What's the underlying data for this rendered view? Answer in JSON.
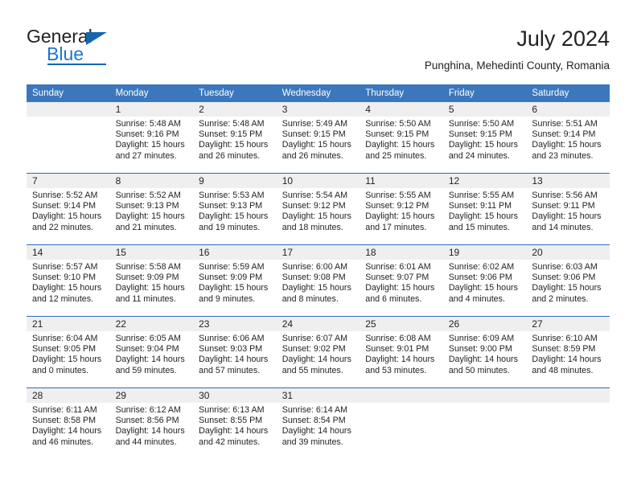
{
  "brand": {
    "name_part1": "General",
    "name_part2": "Blue",
    "logo_icon": "triangle-icon",
    "accent_color": "#1565b0"
  },
  "header": {
    "title": "July 2024",
    "subtitle": "Punghina, Mehedinti County, Romania"
  },
  "theme": {
    "header_blue": "#3b77bc",
    "row_line_blue": "#2d6eb4",
    "daynum_band_gray": "#efeff0",
    "text_color": "#231f20"
  },
  "columns": [
    "Sunday",
    "Monday",
    "Tuesday",
    "Wednesday",
    "Thursday",
    "Friday",
    "Saturday"
  ],
  "weeks": [
    [
      {
        "day": "",
        "lines": []
      },
      {
        "day": "1",
        "lines": [
          "Sunrise: 5:48 AM",
          "Sunset: 9:16 PM",
          "Daylight: 15 hours",
          "and 27 minutes."
        ]
      },
      {
        "day": "2",
        "lines": [
          "Sunrise: 5:48 AM",
          "Sunset: 9:15 PM",
          "Daylight: 15 hours",
          "and 26 minutes."
        ]
      },
      {
        "day": "3",
        "lines": [
          "Sunrise: 5:49 AM",
          "Sunset: 9:15 PM",
          "Daylight: 15 hours",
          "and 26 minutes."
        ]
      },
      {
        "day": "4",
        "lines": [
          "Sunrise: 5:50 AM",
          "Sunset: 9:15 PM",
          "Daylight: 15 hours",
          "and 25 minutes."
        ]
      },
      {
        "day": "5",
        "lines": [
          "Sunrise: 5:50 AM",
          "Sunset: 9:15 PM",
          "Daylight: 15 hours",
          "and 24 minutes."
        ]
      },
      {
        "day": "6",
        "lines": [
          "Sunrise: 5:51 AM",
          "Sunset: 9:14 PM",
          "Daylight: 15 hours",
          "and 23 minutes."
        ]
      }
    ],
    [
      {
        "day": "7",
        "lines": [
          "Sunrise: 5:52 AM",
          "Sunset: 9:14 PM",
          "Daylight: 15 hours",
          "and 22 minutes."
        ]
      },
      {
        "day": "8",
        "lines": [
          "Sunrise: 5:52 AM",
          "Sunset: 9:13 PM",
          "Daylight: 15 hours",
          "and 21 minutes."
        ]
      },
      {
        "day": "9",
        "lines": [
          "Sunrise: 5:53 AM",
          "Sunset: 9:13 PM",
          "Daylight: 15 hours",
          "and 19 minutes."
        ]
      },
      {
        "day": "10",
        "lines": [
          "Sunrise: 5:54 AM",
          "Sunset: 9:12 PM",
          "Daylight: 15 hours",
          "and 18 minutes."
        ]
      },
      {
        "day": "11",
        "lines": [
          "Sunrise: 5:55 AM",
          "Sunset: 9:12 PM",
          "Daylight: 15 hours",
          "and 17 minutes."
        ]
      },
      {
        "day": "12",
        "lines": [
          "Sunrise: 5:55 AM",
          "Sunset: 9:11 PM",
          "Daylight: 15 hours",
          "and 15 minutes."
        ]
      },
      {
        "day": "13",
        "lines": [
          "Sunrise: 5:56 AM",
          "Sunset: 9:11 PM",
          "Daylight: 15 hours",
          "and 14 minutes."
        ]
      }
    ],
    [
      {
        "day": "14",
        "lines": [
          "Sunrise: 5:57 AM",
          "Sunset: 9:10 PM",
          "Daylight: 15 hours",
          "and 12 minutes."
        ]
      },
      {
        "day": "15",
        "lines": [
          "Sunrise: 5:58 AM",
          "Sunset: 9:09 PM",
          "Daylight: 15 hours",
          "and 11 minutes."
        ]
      },
      {
        "day": "16",
        "lines": [
          "Sunrise: 5:59 AM",
          "Sunset: 9:09 PM",
          "Daylight: 15 hours",
          "and 9 minutes."
        ]
      },
      {
        "day": "17",
        "lines": [
          "Sunrise: 6:00 AM",
          "Sunset: 9:08 PM",
          "Daylight: 15 hours",
          "and 8 minutes."
        ]
      },
      {
        "day": "18",
        "lines": [
          "Sunrise: 6:01 AM",
          "Sunset: 9:07 PM",
          "Daylight: 15 hours",
          "and 6 minutes."
        ]
      },
      {
        "day": "19",
        "lines": [
          "Sunrise: 6:02 AM",
          "Sunset: 9:06 PM",
          "Daylight: 15 hours",
          "and 4 minutes."
        ]
      },
      {
        "day": "20",
        "lines": [
          "Sunrise: 6:03 AM",
          "Sunset: 9:06 PM",
          "Daylight: 15 hours",
          "and 2 minutes."
        ]
      }
    ],
    [
      {
        "day": "21",
        "lines": [
          "Sunrise: 6:04 AM",
          "Sunset: 9:05 PM",
          "Daylight: 15 hours",
          "and 0 minutes."
        ]
      },
      {
        "day": "22",
        "lines": [
          "Sunrise: 6:05 AM",
          "Sunset: 9:04 PM",
          "Daylight: 14 hours",
          "and 59 minutes."
        ]
      },
      {
        "day": "23",
        "lines": [
          "Sunrise: 6:06 AM",
          "Sunset: 9:03 PM",
          "Daylight: 14 hours",
          "and 57 minutes."
        ]
      },
      {
        "day": "24",
        "lines": [
          "Sunrise: 6:07 AM",
          "Sunset: 9:02 PM",
          "Daylight: 14 hours",
          "and 55 minutes."
        ]
      },
      {
        "day": "25",
        "lines": [
          "Sunrise: 6:08 AM",
          "Sunset: 9:01 PM",
          "Daylight: 14 hours",
          "and 53 minutes."
        ]
      },
      {
        "day": "26",
        "lines": [
          "Sunrise: 6:09 AM",
          "Sunset: 9:00 PM",
          "Daylight: 14 hours",
          "and 50 minutes."
        ]
      },
      {
        "day": "27",
        "lines": [
          "Sunrise: 6:10 AM",
          "Sunset: 8:59 PM",
          "Daylight: 14 hours",
          "and 48 minutes."
        ]
      }
    ],
    [
      {
        "day": "28",
        "lines": [
          "Sunrise: 6:11 AM",
          "Sunset: 8:58 PM",
          "Daylight: 14 hours",
          "and 46 minutes."
        ]
      },
      {
        "day": "29",
        "lines": [
          "Sunrise: 6:12 AM",
          "Sunset: 8:56 PM",
          "Daylight: 14 hours",
          "and 44 minutes."
        ]
      },
      {
        "day": "30",
        "lines": [
          "Sunrise: 6:13 AM",
          "Sunset: 8:55 PM",
          "Daylight: 14 hours",
          "and 42 minutes."
        ]
      },
      {
        "day": "31",
        "lines": [
          "Sunrise: 6:14 AM",
          "Sunset: 8:54 PM",
          "Daylight: 14 hours",
          "and 39 minutes."
        ]
      },
      {
        "day": "",
        "lines": []
      },
      {
        "day": "",
        "lines": []
      },
      {
        "day": "",
        "lines": []
      }
    ]
  ]
}
